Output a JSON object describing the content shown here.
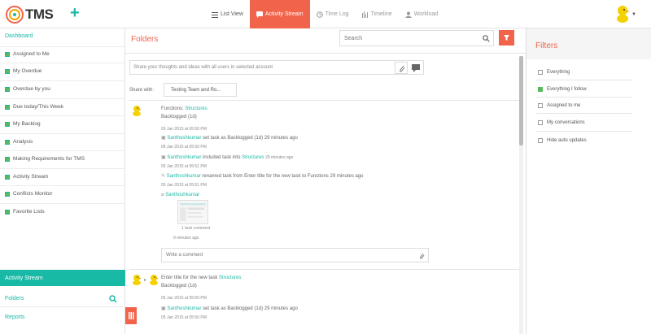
{
  "app": {
    "name": "TMS"
  },
  "nav": [
    {
      "label": "List View",
      "state": "normal",
      "icon": "list-icon"
    },
    {
      "label": "Activity Stream",
      "state": "active",
      "icon": "chat-icon"
    },
    {
      "label": "Time Log",
      "state": "muted",
      "icon": "clock-icon"
    },
    {
      "label": "Timeline",
      "state": "muted",
      "icon": "timeline-icon"
    },
    {
      "label": "Workload",
      "state": "muted",
      "icon": "user-icon"
    }
  ],
  "sidebar": {
    "dashboard": "Dashboard",
    "items": [
      "Assigned to Me",
      "My Overdue",
      "Overdue by you",
      "Due today/This Week",
      "My Backlog",
      "Analysis",
      "Making Requirements for TMS",
      "Activity Stream",
      "Conflicts Monitor",
      "Favorite Lists"
    ],
    "active": "Activity Stream",
    "folders": "Folders",
    "reports": "Reports"
  },
  "main": {
    "title": "Folders",
    "search_placeholder": "Search",
    "composer_placeholder": "Share your thoughts and ideas with all users in selected account",
    "share_label": "Share with:",
    "share_value": "Testing Team and Ro...",
    "entries": [
      {
        "folder": "Functions:",
        "folder_link": "Structures",
        "status": "Backlogged (1d)",
        "time1": "05 Jan 2015 at 05:50 PM",
        "line1_user": "Santhoshkumar",
        "line1_text": "set task as Backlogged (1d) 29 minutes ago",
        "time2": "05 Jan 2015 at 05:50 PM",
        "line2_user": "Santhoshkumar",
        "line2_text": "included task into",
        "line2_link": "Structures",
        "line2_ago": "29 minutes ago",
        "time3": "05 Jan 2015 at 05:51 PM",
        "line3_user": "Santhoshkumar",
        "line3_text": "renamed task from Enter title for the new task to Functions 29 minutes ago",
        "time4": "05 Jan 2015 at 05:51 PM",
        "line4_user": "Santhoshkumar",
        "thumb_caption": "1 task comment",
        "thumb_ago": "9 minutes ago",
        "comment_placeholder": "Write a comment"
      },
      {
        "folder": "Enter title for the new task",
        "folder_link": "Structures",
        "status": "Backlogged (1d)",
        "time1": "05 Jan 2015 at 05:50 PM",
        "line1_user": "Santhoshkumar",
        "line1_text": "set task as Backlogged (1d) 29 minutes ago",
        "time2": "05 Jan 2015 at 05:50 PM"
      }
    ]
  },
  "filters": {
    "title": "Filters",
    "items": [
      {
        "label": "Everything",
        "checked": false
      },
      {
        "label": "Everything I follow",
        "checked": true
      },
      {
        "label": "Assigned to me",
        "checked": false
      },
      {
        "label": "My conversations",
        "checked": false
      },
      {
        "label": "Hide auto updates",
        "checked": false
      }
    ]
  },
  "colors": {
    "accent_teal": "#18b9a5",
    "accent_orange": "#f2634c"
  }
}
